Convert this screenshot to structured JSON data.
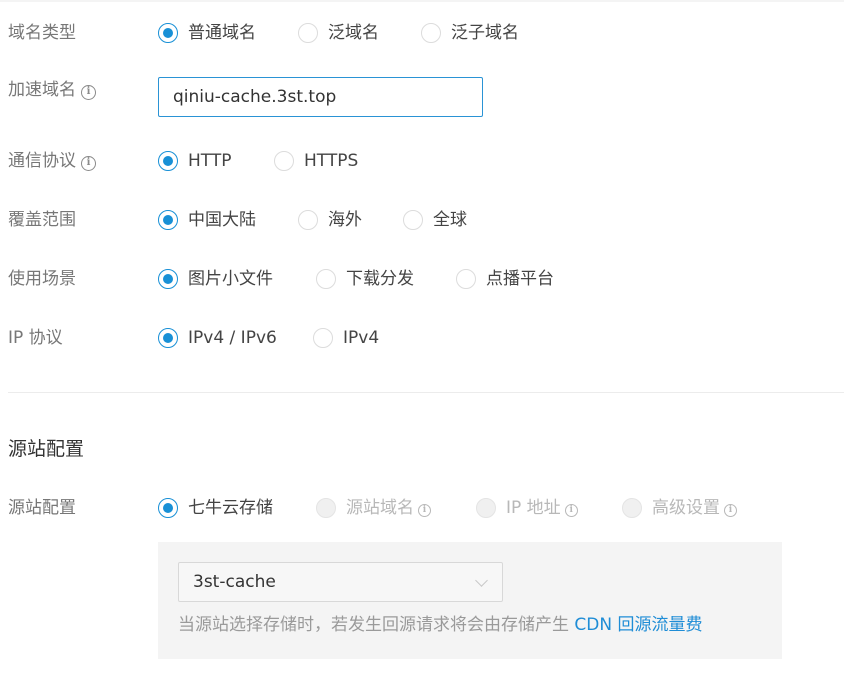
{
  "domain_type": {
    "label": "域名类型",
    "options": [
      "普通域名",
      "泛域名",
      "泛子域名"
    ],
    "selected": "普通域名"
  },
  "accelerated_domain": {
    "label": "加速域名",
    "value": "qiniu-cache.3st.top"
  },
  "protocol": {
    "label": "通信协议",
    "options": [
      "HTTP",
      "HTTPS"
    ],
    "selected": "HTTP"
  },
  "coverage": {
    "label": "覆盖范围",
    "options": [
      "中国大陆",
      "海外",
      "全球"
    ],
    "selected": "中国大陆"
  },
  "scenario": {
    "label": "使用场景",
    "options": [
      "图片小文件",
      "下载分发",
      "点播平台"
    ],
    "selected": "图片小文件"
  },
  "ip_protocol": {
    "label": "IP 协议",
    "options": [
      "IPv4 / IPv6",
      "IPv4"
    ],
    "selected": "IPv4 / IPv6"
  },
  "origin_section": {
    "title": "源站配置"
  },
  "origin": {
    "label": "源站配置",
    "options": [
      "七牛云存储",
      "源站域名",
      "IP 地址",
      "高级设置"
    ],
    "selected": "七牛云存储",
    "disabled": [
      "源站域名",
      "IP 地址",
      "高级设置"
    ],
    "bucket_value": "3st-cache",
    "hint_text": "当源站选择存储时，若发生回源请求将会由存储产生",
    "hint_link": "CDN 回源流量费"
  },
  "colors": {
    "accent": "#1890d6",
    "link": "#1f8dd6",
    "panel_bg": "#f4f4f4"
  },
  "icons": [
    "info-icon",
    "chevron-down-icon"
  ]
}
